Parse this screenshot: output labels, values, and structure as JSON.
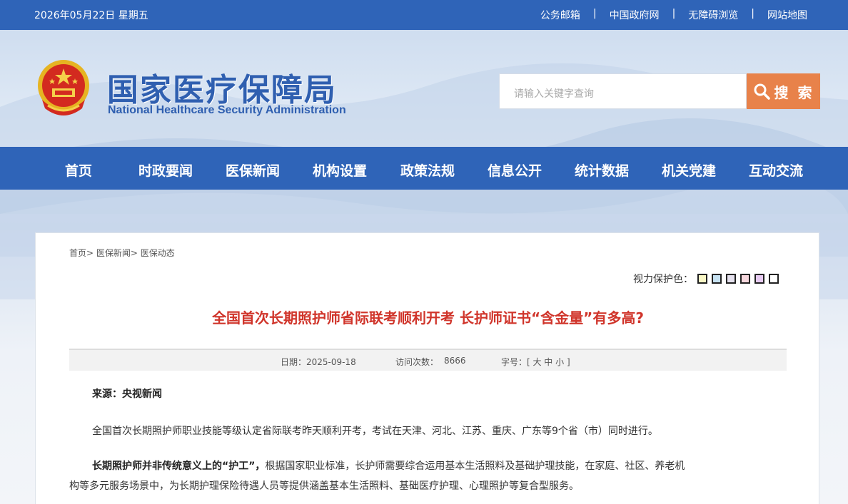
{
  "topbar": {
    "date": "2026年05月22日 星期五",
    "links": [
      "公务邮箱",
      "中国政府网",
      "无障碍浏览",
      "网站地图"
    ],
    "separator": "|"
  },
  "header": {
    "title_cn": "国家医疗保障局",
    "title_en": "National Healthcare Security Administration",
    "search_placeholder": "请输入关键字查询",
    "search_button": "搜 索"
  },
  "nav": [
    "首页",
    "时政要闻",
    "医保新闻",
    "机构设置",
    "政策法规",
    "信息公开",
    "统计数据",
    "机关党建",
    "互动交流"
  ],
  "breadcrumb": [
    "首页>",
    "医保新闻>",
    "医保动态"
  ],
  "vision": {
    "label": "视力保护色：",
    "colors": [
      "#f9f7c6",
      "#c7e2f2",
      "#e5e1ee",
      "#f7d8de",
      "#e7cbf2",
      "#ffffff"
    ]
  },
  "article": {
    "title": "全国首次长期照护师省际联考顺利开考 长护师证书“含金量”有多高?",
    "date_label": "日期：2025-09-18",
    "visits_label": "访问次数：",
    "visits": "8666",
    "font_label": "字号：[ 大 中 小 ]",
    "source": "来源：央视新闻",
    "para1": "全国首次长期照护师职业技能等级认定省际联考昨天顺利开考，考试在天津、河北、江苏、重庆、广东等9个省（市）同时进行。",
    "para2_bold": "长期照护师并非传统意义上的“护工”，",
    "para2_rest": "根据国家职业标准，长护师需要综合运用基本生活照料及基础护理技能，在家庭、社区、养老机",
    "para2_line2": "构等多元服务场景中，为长期护理保险待遇人员等提供涵盖基本生活照料、基础医疗护理、心理照护等复合型服务。"
  },
  "colors": {
    "brand_blue": "#2f64b8",
    "title_red": "#d0352b",
    "search_orange": "#e8824a"
  }
}
